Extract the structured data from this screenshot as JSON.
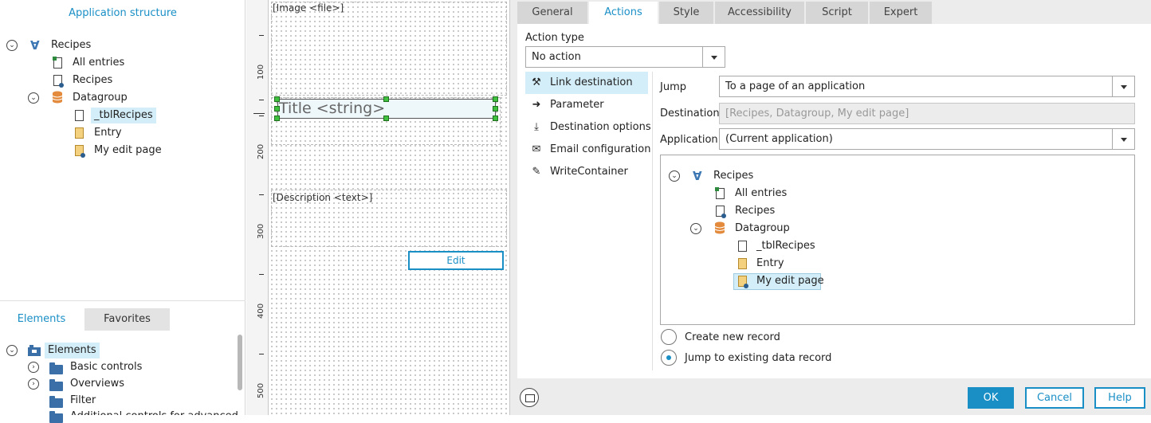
{
  "app_structure": {
    "title": "Application structure",
    "tree": [
      {
        "label": "Recipes",
        "icon": "app-icon"
      },
      {
        "label": "All entries",
        "icon": "page-overview-icon"
      },
      {
        "label": "Recipes",
        "icon": "page-view-icon"
      },
      {
        "label": "Datagroup",
        "icon": "datagroup-icon"
      },
      {
        "label": "_tblRecipes",
        "icon": "table-icon",
        "selected": true
      },
      {
        "label": "Entry",
        "icon": "entry-icon"
      },
      {
        "label": "My edit page",
        "icon": "edit-page-icon"
      }
    ]
  },
  "elements_panel": {
    "tabs": [
      "Elements",
      "Favorites"
    ],
    "active_tab": "Elements",
    "tree": [
      {
        "label": "Elements",
        "icon": "elements-box-icon",
        "selected": true
      },
      {
        "label": "Basic controls",
        "icon": "folder-icon"
      },
      {
        "label": "Overviews",
        "icon": "folder-icon"
      },
      {
        "label": "Filter",
        "icon": "folder-icon"
      },
      {
        "label": "Additional controls for advanced",
        "icon": "folder-icon"
      }
    ]
  },
  "ruler": {
    "marks": [
      "100",
      "200",
      "300",
      "400",
      "500"
    ]
  },
  "canvas": {
    "image_field": "[Image <file>]",
    "title_field": "Title <string>",
    "description_field": "[Description <text>]",
    "edit_button": "Edit"
  },
  "dialog": {
    "tabs": [
      "General",
      "Actions",
      "Style",
      "Accessibility",
      "Script",
      "Expert"
    ],
    "active_tab": "Actions",
    "action_type_label": "Action type",
    "action_type_value": "No action",
    "menu": [
      {
        "label": "Link destination",
        "icon": "hammer-icon",
        "active": true
      },
      {
        "label": "Parameter",
        "icon": "arrow-right-icon"
      },
      {
        "label": "Destination options",
        "icon": "download-icon"
      },
      {
        "label": "Email configuration",
        "icon": "envelope-icon"
      },
      {
        "label": "WriteContainer",
        "icon": "pencil-icon"
      }
    ],
    "jump_label": "Jump",
    "jump_value": "To a page of an application",
    "destination_label": "Destination",
    "destination_value": "[Recipes, Datagroup, My edit page]",
    "application_label": "Application",
    "application_value": "(Current application)",
    "tree": [
      {
        "label": "Recipes",
        "icon": "app-icon"
      },
      {
        "label": "All entries",
        "icon": "page-overview-icon"
      },
      {
        "label": "Recipes",
        "icon": "page-view-icon"
      },
      {
        "label": "Datagroup",
        "icon": "datagroup-icon"
      },
      {
        "label": "_tblRecipes",
        "icon": "table-icon"
      },
      {
        "label": "Entry",
        "icon": "entry-icon"
      },
      {
        "label": "My edit page",
        "icon": "edit-page-icon",
        "selected": true
      }
    ],
    "radio_create": "Create new record",
    "radio_existing": "Jump to existing data record",
    "radio_selected": "Jump to existing data record",
    "buttons": {
      "ok": "OK",
      "cancel": "Cancel",
      "help": "Help"
    },
    "accent_color": "#1a8fc6"
  }
}
